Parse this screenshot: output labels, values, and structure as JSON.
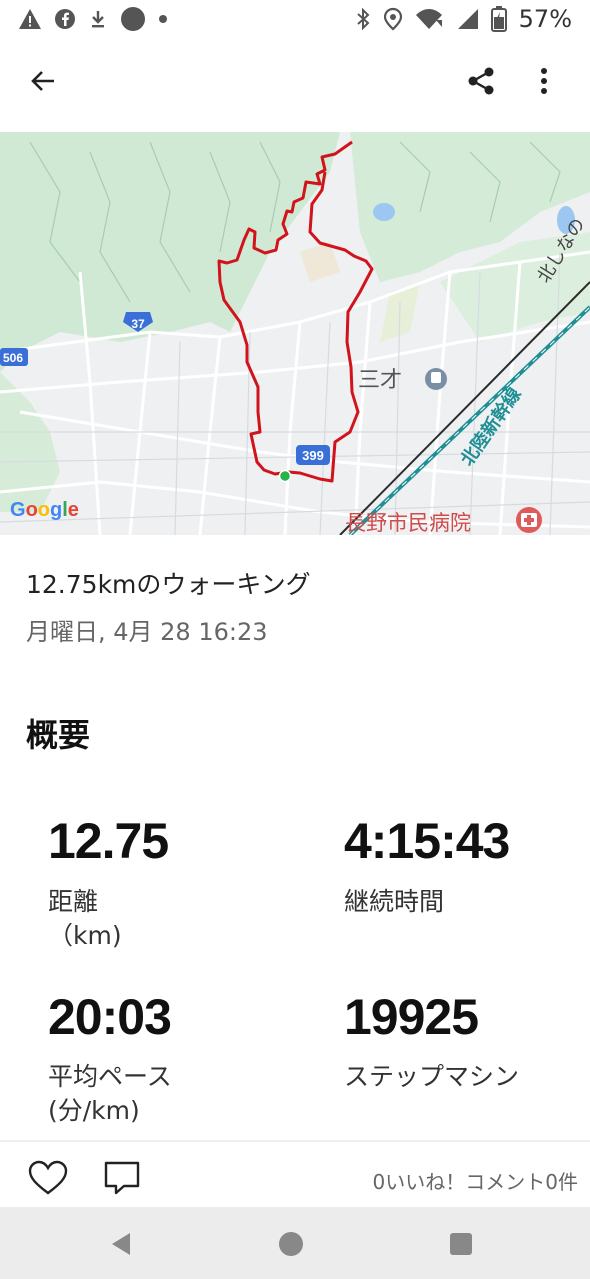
{
  "status_bar": {
    "battery": "57%",
    "icons_left": [
      "warning-icon",
      "facebook-icon",
      "download-icon",
      "circle-dot-icon",
      "small-dot-icon"
    ],
    "icons_right": [
      "bluetooth-icon",
      "location-icon",
      "wifi-icon",
      "signal-icon",
      "battery-icon"
    ]
  },
  "app_bar": {
    "back_icon": "arrow-back-icon",
    "share_icon": "share-icon",
    "more_icon": "more-vert-icon"
  },
  "map": {
    "google_logo": "Google",
    "route_badge": "399",
    "road_badges": [
      "37",
      "506"
    ],
    "labels": {
      "station": "三才",
      "rail_line": "北陸新幹線",
      "rail_line_2": "北しなの",
      "hospital": "長野市民病院"
    },
    "colors": {
      "route": "#d1131c",
      "start_marker": "#25b34a",
      "greenery": "#cfe9d4",
      "road_shield": "#3a6fd8"
    }
  },
  "activity": {
    "title": "12.75kmのウォーキング",
    "date": "月曜日, 4月 28 16:23"
  },
  "overview": {
    "heading": "概要",
    "stats": [
      {
        "value": "12.75",
        "label": "距離",
        "unit": "（km)"
      },
      {
        "value": "4:15:43",
        "label": "継続時間",
        "unit": ""
      },
      {
        "value": "20:03",
        "label": "平均ペース",
        "unit": "(分/km)"
      },
      {
        "value": "19925",
        "label": "ステップマシン",
        "unit": ""
      }
    ]
  },
  "actions": {
    "like_icon": "heart-icon",
    "comment_icon": "comment-icon",
    "meta": "0いいね！コメント0件"
  },
  "nav_bar": {
    "back": "nav-back-icon",
    "home": "nav-home-icon",
    "recents": "nav-recents-icon"
  }
}
